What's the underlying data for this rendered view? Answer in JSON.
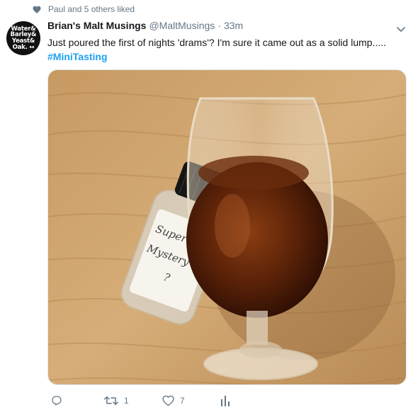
{
  "social_context": {
    "icon": "heart-icon",
    "text": "Paul and 5 others liked"
  },
  "author": {
    "avatar_lines": [
      "Water&",
      "Barley&",
      "Yeast&",
      "Oak. ↔"
    ],
    "display_name": "Brian's Malt Musings",
    "handle": "@MaltMusings",
    "separator": "·",
    "time": "33m"
  },
  "tweet": {
    "text": "Just poured the first of nights 'drams'? I'm sure it came out as a solid lump.....",
    "hashtag": "#MiniTasting",
    "hashtag_color": "#1da1f2"
  },
  "media": {
    "bottle_label_lines": [
      "Super Secret",
      "Mystery dram",
      "?"
    ]
  },
  "actions": {
    "reply": {
      "icon": "reply-icon",
      "count": ""
    },
    "retweet": {
      "icon": "retweet-icon",
      "count": "1"
    },
    "like": {
      "icon": "heart-outline-icon",
      "count": "7"
    },
    "analytics": {
      "icon": "analytics-icon",
      "count": ""
    }
  },
  "colors": {
    "text": "#14171a",
    "secondary": "#657786",
    "link": "#1da1f2"
  }
}
